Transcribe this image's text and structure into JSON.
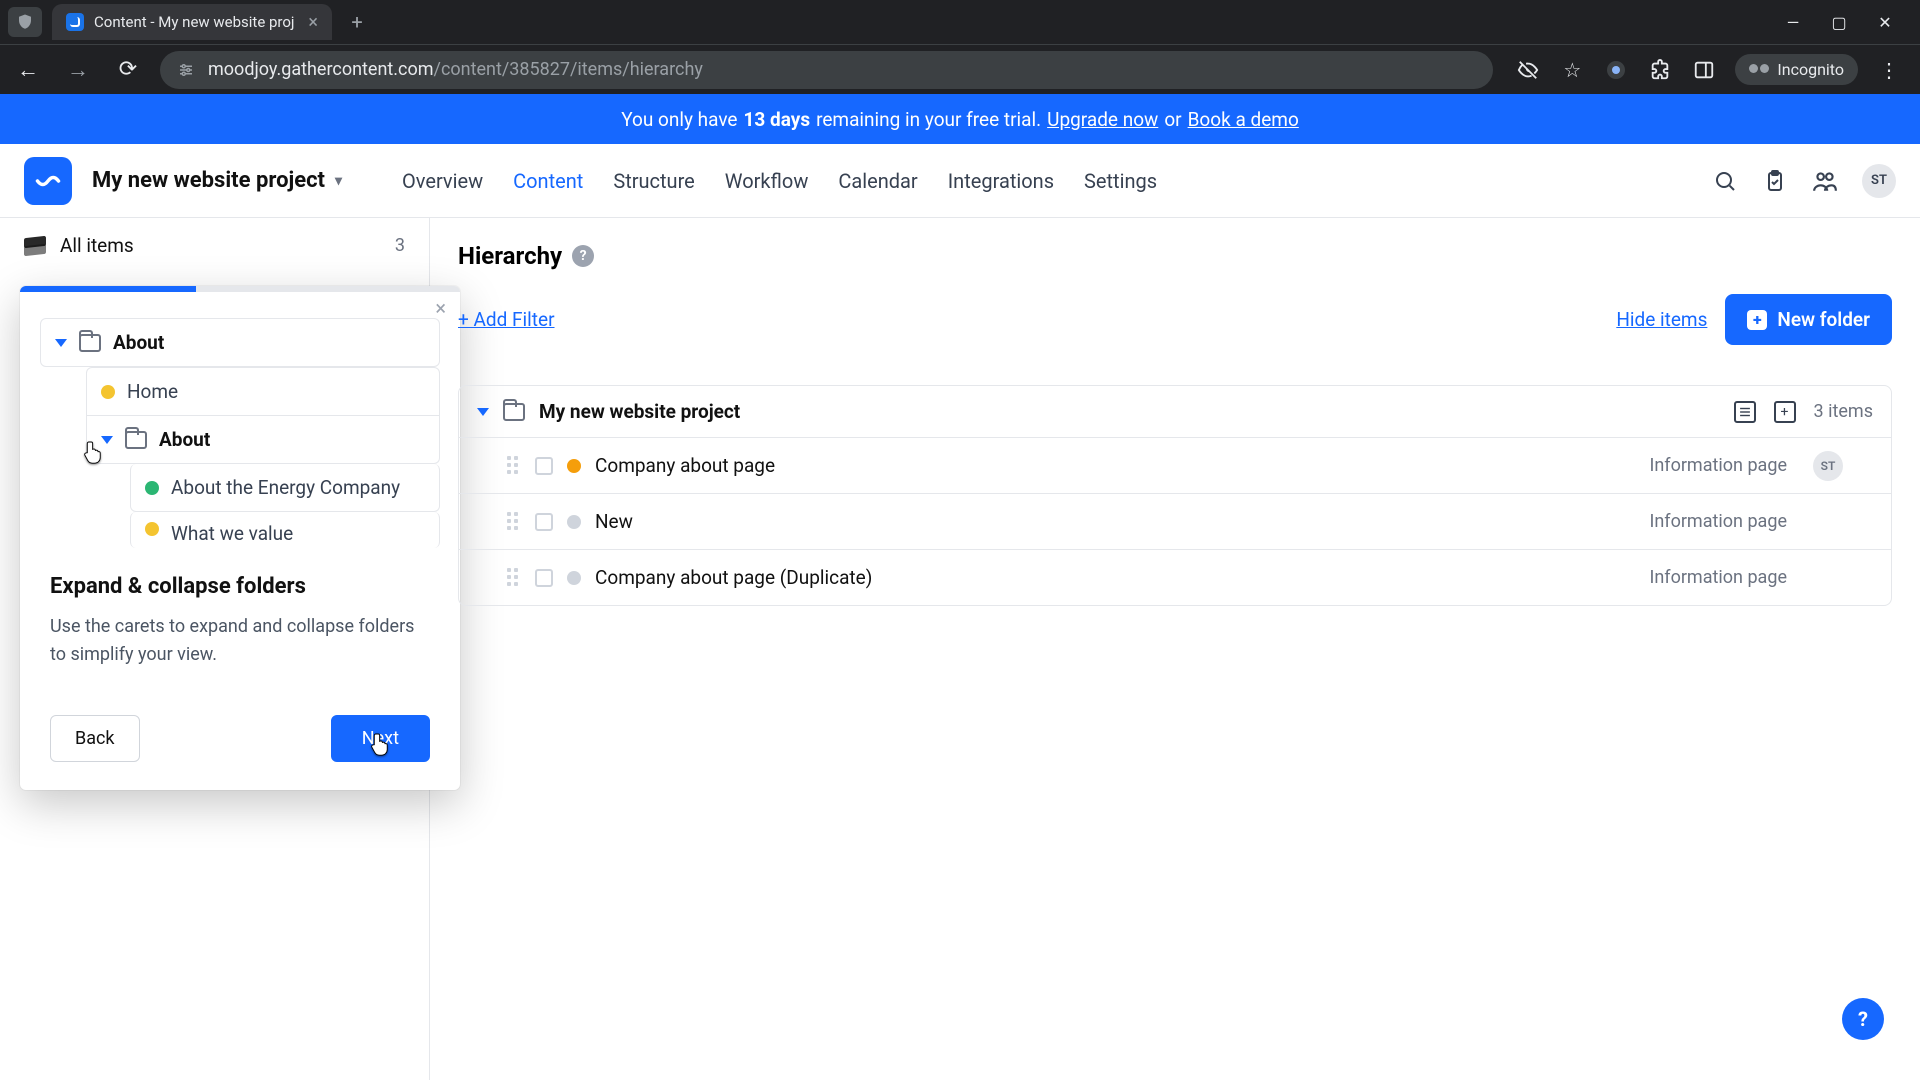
{
  "browser": {
    "tab_title": "Content - My new website proj",
    "url_host": "moodjoy.gathercontent.com",
    "url_path": "/content/385827/items/hierarchy",
    "incognito_label": "Incognito"
  },
  "trial_banner": {
    "prefix": "You only have ",
    "days": "13 days",
    "middle": " remaining in your free trial. ",
    "upgrade": "Upgrade now",
    "or": " or ",
    "demo": "Book a demo"
  },
  "header": {
    "project_title": "My new website project",
    "nav": [
      "Overview",
      "Content",
      "Structure",
      "Workflow",
      "Calendar",
      "Integrations",
      "Settings"
    ],
    "active_nav": "Content",
    "avatar": "ST"
  },
  "sidebar": {
    "all_items_label": "All items",
    "all_items_count": "3"
  },
  "tour": {
    "progress_percent": 40,
    "folder_about": "About",
    "item_home": "Home",
    "folder_about2": "About",
    "item_energy": "About the Energy Company",
    "item_value": "What we value",
    "title": "Expand & collapse folders",
    "body": "Use the carets to expand and collapse folders to simplify your view.",
    "back": "Back",
    "next": "Next"
  },
  "main": {
    "title": "Hierarchy",
    "add_filter": "+ Add Filter",
    "hide_items": "Hide items",
    "new_folder": "New folder",
    "root_folder": "My new website project",
    "items_count": "3 items",
    "rows": [
      {
        "title": "Company about page",
        "type": "Information page",
        "dot": "orange",
        "avatar": "ST"
      },
      {
        "title": "New",
        "type": "Information page",
        "dot": "grey",
        "avatar": ""
      },
      {
        "title": "Company about page (Duplicate)",
        "type": "Information page",
        "dot": "grey",
        "avatar": ""
      }
    ]
  },
  "colors": {
    "primary": "#1668ff"
  }
}
